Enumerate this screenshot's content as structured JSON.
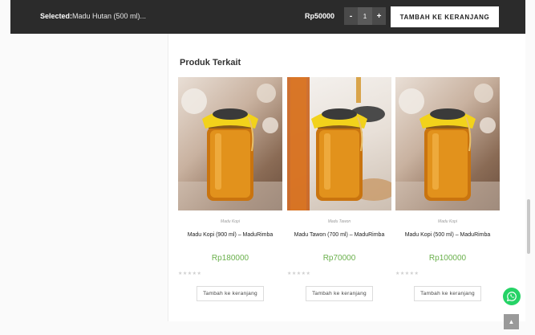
{
  "sticky_bar": {
    "selected_label": "Selected:",
    "selected_value": "Madu Hutan (500 ml)...",
    "price": "Rp50000",
    "qty_minus": "-",
    "qty_value": "1",
    "qty_plus": "+",
    "add_to_cart": "TAMBAH KE KERANJANG"
  },
  "related": {
    "title": "Produk Terkait",
    "products": [
      {
        "category": "Madu Kopi",
        "name": "Madu Kopi (900 ml) – MaduRimba",
        "price": "Rp180000",
        "stars": "★★★★★",
        "button": "Tambah ke keranjang"
      },
      {
        "category": "Madu Tawon",
        "name": "Madu Tawon (700 ml) – MaduRimba",
        "price": "Rp70000",
        "stars": "★★★★★",
        "button": "Tambah ke keranjang"
      },
      {
        "category": "Madu Kopi",
        "name": "Madu Kopi (500 ml) – MaduRimba",
        "price": "Rp100000",
        "stars": "★★★★★",
        "button": "Tambah ke keranjang"
      }
    ]
  },
  "icons": {
    "whatsapp": "whatsapp-icon",
    "back_to_top": "chevron-up-icon"
  },
  "colors": {
    "bar_bg": "#2b2b2b",
    "price_green": "#6ab04c",
    "honey": "#d98a16",
    "lid_yellow": "#f2d21b",
    "whatsapp_green": "#25d366"
  }
}
